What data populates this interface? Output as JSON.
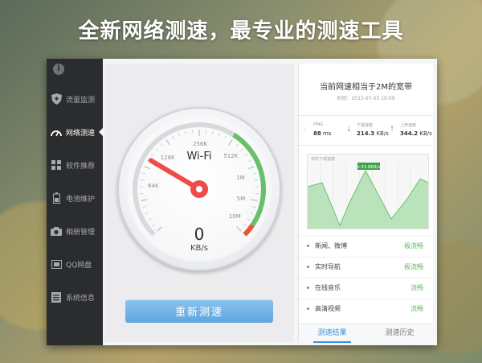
{
  "headline": "全新网络测速，最专业的测速工具",
  "sidebar": {
    "items": [
      {
        "label": "流量监测",
        "icon": "shield-icon"
      },
      {
        "label": "网络测速",
        "icon": "speedometer-icon"
      },
      {
        "label": "软件推荐",
        "icon": "apps-grid-icon"
      },
      {
        "label": "电池维护",
        "icon": "battery-icon"
      },
      {
        "label": "相册管理",
        "icon": "camera-icon"
      },
      {
        "label": "QQ网盘",
        "icon": "folder-icon"
      },
      {
        "label": "系统信息",
        "icon": "info-list-icon"
      }
    ],
    "active_index": 1
  },
  "gauge": {
    "title": "Wi-Fi",
    "value": "0",
    "unit": "KB/s",
    "ticks": [
      "64K",
      "128K",
      "256K",
      "512K",
      "1M",
      "5M",
      "10M"
    ],
    "needle_fraction": 0.28
  },
  "retest_label": "重新测速",
  "result": {
    "title": "当前网速相当于2M的宽带",
    "time": "时间：2013-07-05 10:09",
    "stats": [
      {
        "label": "PING",
        "value": "88",
        "unit": "ms",
        "icon": "ping-icon"
      },
      {
        "label": "下载速度",
        "value": "214.3",
        "unit": "KB/s",
        "icon": "download-icon"
      },
      {
        "label": "上传速度",
        "value": "344.2",
        "unit": "KB/s",
        "icon": "upload-icon"
      }
    ],
    "chart_caption": "实时下载速度",
    "chart_marker": "+33.8KB/s",
    "list": [
      {
        "name": "新闻、微博",
        "status": "极流畅"
      },
      {
        "name": "实时导航",
        "status": "极流畅"
      },
      {
        "name": "在线音乐",
        "status": "流畅"
      },
      {
        "name": "高清视频",
        "status": "流畅"
      }
    ],
    "tabs": [
      {
        "label": "测速结果"
      },
      {
        "label": "测速历史"
      }
    ]
  },
  "colors": {
    "accent": "#3b8fd6",
    "green": "#5cb85c",
    "needle": "#ef4b4b"
  }
}
